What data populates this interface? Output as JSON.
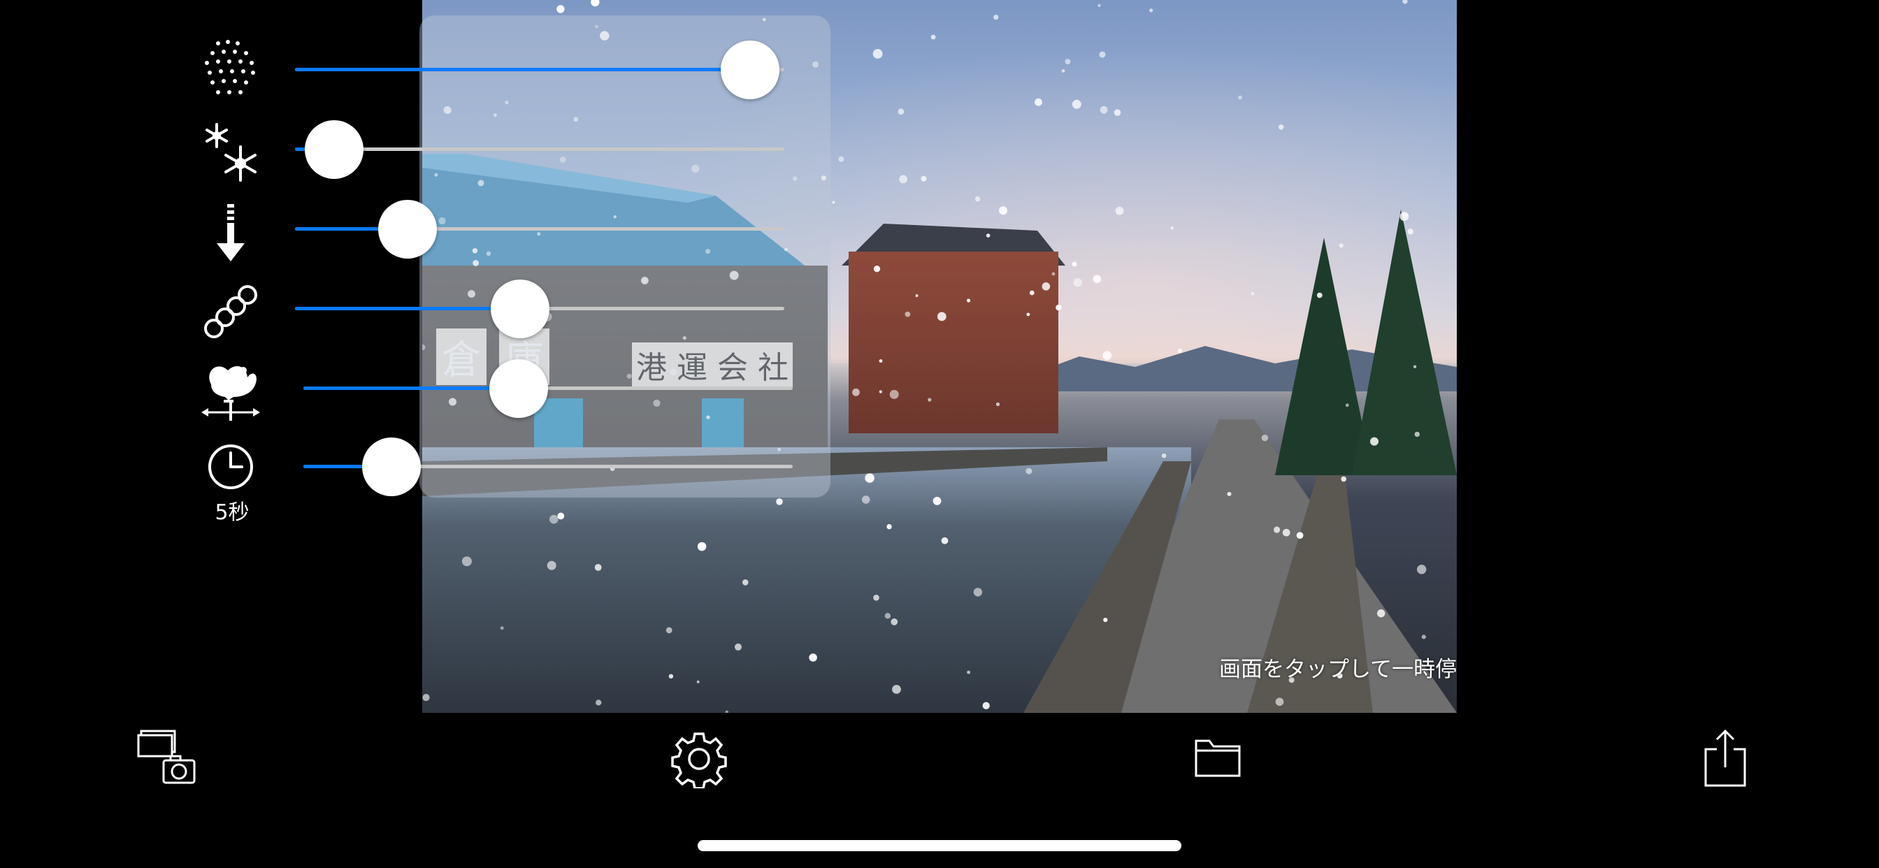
{
  "overlay": {
    "hint": "画面をタップして一時停止"
  },
  "controls": [
    {
      "id": "density",
      "icon": "snow-density-icon",
      "value": 0.93
    },
    {
      "id": "size",
      "icon": "snowflake-size-icon",
      "value": 0.08
    },
    {
      "id": "fall-speed",
      "icon": "down-arrow-icon",
      "value": 0.23
    },
    {
      "id": "motion-blur",
      "icon": "motion-blur-icon",
      "value": 0.46
    },
    {
      "id": "wind",
      "icon": "weathervane-icon",
      "value": 0.44
    },
    {
      "id": "duration",
      "icon": "clock-icon",
      "value": 0.18,
      "label": "5秒"
    }
  ],
  "toolbar": {
    "items": [
      {
        "id": "gallery-camera",
        "icon": "photos-camera-icon"
      },
      {
        "id": "settings",
        "icon": "gear-icon"
      },
      {
        "id": "folder",
        "icon": "folder-icon"
      },
      {
        "id": "share",
        "icon": "share-icon"
      }
    ]
  },
  "colors": {
    "accent": "#0a7aff",
    "background": "#000000"
  }
}
